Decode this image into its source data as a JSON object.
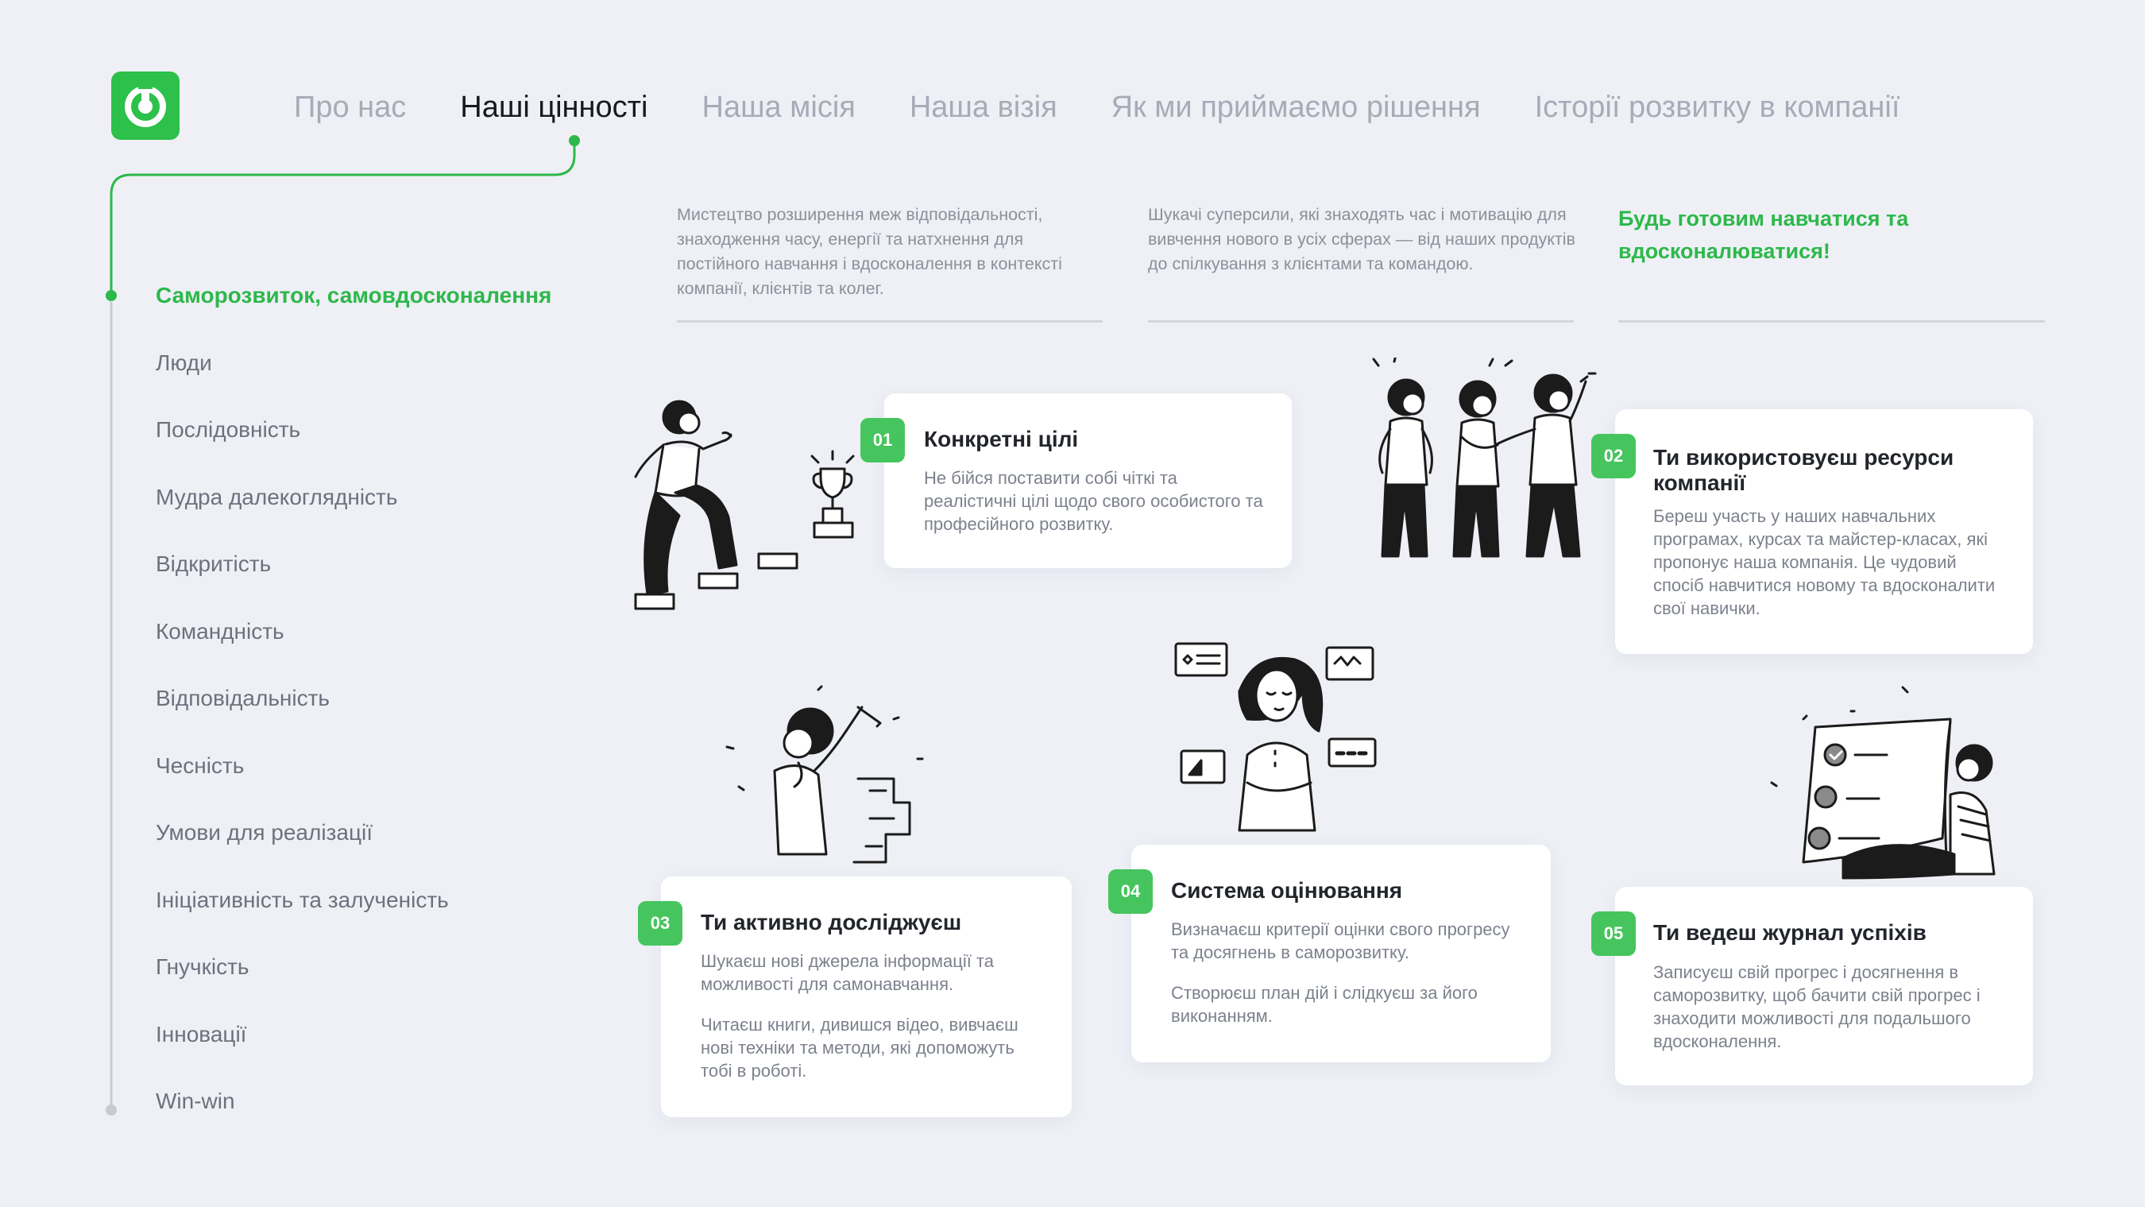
{
  "header": {
    "nav": [
      {
        "label": "Про нас",
        "active": false
      },
      {
        "label": "Наші цінності",
        "active": true
      },
      {
        "label": "Наша місія",
        "active": false
      },
      {
        "label": "Наша візія",
        "active": false
      },
      {
        "label": "Як ми приймаємо рішення",
        "active": false
      },
      {
        "label": "Історії розвитку в компанії",
        "active": false
      }
    ]
  },
  "sidebar": {
    "items": [
      "Саморозвиток, самовдосконалення",
      "Люди",
      "Послідовність",
      "Мудра далекоглядність",
      "Відкритість",
      "Командність",
      "Відповідальність",
      "Чесність",
      "Умови для реалізації",
      "Ініціативність та залученість",
      "Гнучкість",
      "Інновації",
      "Win-win"
    ],
    "active_index": 0
  },
  "intro": {
    "col1": "Мистецтво розширення меж відповідальності, знаходження часу, енергії та натхнення для постійного навчання і вдосконалення в контексті компанії, клієнтів та колег.",
    "col2": "Шукачі суперсили, які знаходять час і мотивацію для вивчення нового в усіх сферах — від наших продуктів до спілкування з клієнтами та командою.",
    "motto": "Будь готовим навчатися та вдосконалюватися!"
  },
  "cards": [
    {
      "num": "01",
      "title": "Конкретні цілі",
      "text": [
        "Не бійся поставити собі чіткі та реалістичні цілі щодо свого особистого та професійного розвитку."
      ]
    },
    {
      "num": "02",
      "title": "Ти використовуєш ресурси компанії",
      "text": [
        "Береш участь у наших навчальних програмах, курсах та майстер-класах, які пропонує наша компанія. Це чудовий спосіб навчитися новому та вдосконалити свої навички."
      ]
    },
    {
      "num": "03",
      "title": "Ти активно досліджуєш",
      "text": [
        "Шукаєш нові джерела інформації та можливості для самонавчання.",
        "Читаєш книги, дивишся відео, вивчаєш нові техніки та методи, які допоможуть тобі в роботі."
      ]
    },
    {
      "num": "04",
      "title": "Система оцінювання",
      "text": [
        "Визначаєш критерії оцінки свого прогресу та досягнень в саморозвитку.",
        "Створюєш план дій і слідкуєш за його виконанням."
      ]
    },
    {
      "num": "05",
      "title": "Ти ведеш журнал успіхів",
      "text": [
        "Записуєш свій прогрес і досягнення в саморозвитку, щоб бачити свій прогрес і знаходити можливості для подальшого вдосконалення."
      ]
    }
  ],
  "colors": {
    "accent": "#2db84a",
    "badge": "#46c55e",
    "background": "#eef0f6"
  }
}
